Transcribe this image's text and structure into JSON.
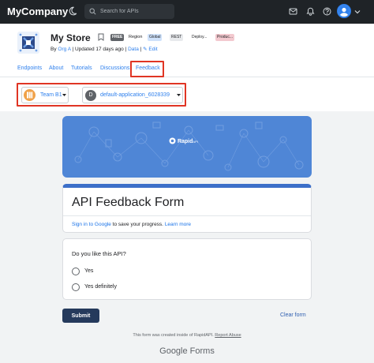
{
  "topbar": {
    "brand": "MyCompany",
    "search_placeholder": "Search for APIs"
  },
  "api": {
    "title": "My Store",
    "badges": {
      "pricing": "FREE",
      "region_label": "Region",
      "region": "Global",
      "protocol": "REST",
      "status1": "Deploy...",
      "status2": "Produc..."
    },
    "byline_by": "By",
    "byline_org": "Org A",
    "byline_updated": "| Updated 17 days ago |",
    "byline_data": "Data",
    "byline_sep": "|",
    "byline_edit": "Edit"
  },
  "tabs": [
    {
      "label": "Endpoints"
    },
    {
      "label": "About"
    },
    {
      "label": "Tutorials"
    },
    {
      "label": "Discussions"
    },
    {
      "label": "Feedback"
    }
  ],
  "selectors": {
    "team": "Team B1",
    "app_initial": "D",
    "app": "default-application_6028339"
  },
  "banner": {
    "brand": "Rapid",
    "brand_suffix": "API"
  },
  "form": {
    "title": "API Feedback Form",
    "sign_in": "Sign in to Google",
    "sign_in_rest": " to save your progress.",
    "learn_more": "Learn more",
    "question": "Do you like this API?",
    "options": [
      {
        "label": "Yes"
      },
      {
        "label": "Yes definitely"
      }
    ],
    "submit": "Submit",
    "clear": "Clear form",
    "footer_note": "This form was created inside of RapidAPI.",
    "report_abuse": "Report Abuse",
    "google_forms": "Google Forms"
  },
  "colors": {
    "topbar_bg": "#1f2327",
    "accent": "#2f80ed",
    "highlight": "#e03524",
    "banner": "#4f86d6",
    "submit": "#253a5c"
  }
}
